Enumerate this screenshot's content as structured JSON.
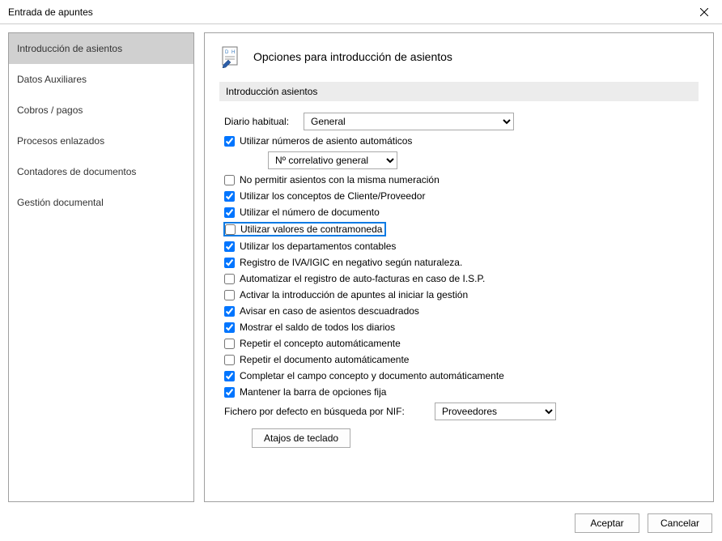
{
  "window": {
    "title": "Entrada de apuntes"
  },
  "sidebar": {
    "items": [
      {
        "label": "Introducción de asientos",
        "selected": true
      },
      {
        "label": "Datos Auxiliares",
        "selected": false
      },
      {
        "label": "Cobros / pagos",
        "selected": false
      },
      {
        "label": "Procesos enlazados",
        "selected": false
      },
      {
        "label": "Contadores de documentos",
        "selected": false
      },
      {
        "label": "Gestión documental",
        "selected": false
      }
    ]
  },
  "main": {
    "header_title": "Opciones para introducción de asientos",
    "section_title": "Introducción asientos",
    "diario_label": "Diario habitual:",
    "diario_value": "General",
    "correlativo_value": "Nº correlativo general",
    "no_permitir_label": "No permitir asientos con la misma numeración",
    "checks": {
      "auto_num": "Utilizar números de asiento automáticos",
      "conceptos_cp": "Utilizar los conceptos de Cliente/Proveedor",
      "num_doc": "Utilizar el número de documento",
      "contramoneda": "Utilizar valores de contramoneda",
      "departamentos": "Utilizar los departamentos contables",
      "iva_igic": "Registro de IVA/IGIC en negativo según naturaleza.",
      "autofacturas": "Automatizar el registro de auto-facturas en caso de I.S.P.",
      "activar_inicio": "Activar la introducción de apuntes al iniciar la gestión",
      "avisar_descuadrados": "Avisar en caso de asientos descuadrados",
      "mostrar_saldo": "Mostrar el saldo de todos los diarios",
      "repetir_concepto": "Repetir el concepto automáticamente",
      "repetir_documento": "Repetir el documento automáticamente",
      "completar_concepto": "Completar el campo concepto y documento automáticamente",
      "mantener_barra": "Mantener la barra de opciones fija"
    },
    "fichero_label": "Fichero por defecto en búsqueda por NIF:",
    "fichero_value": "Proveedores",
    "atajos_label": "Atajos de teclado"
  },
  "footer": {
    "accept": "Aceptar",
    "cancel": "Cancelar"
  }
}
